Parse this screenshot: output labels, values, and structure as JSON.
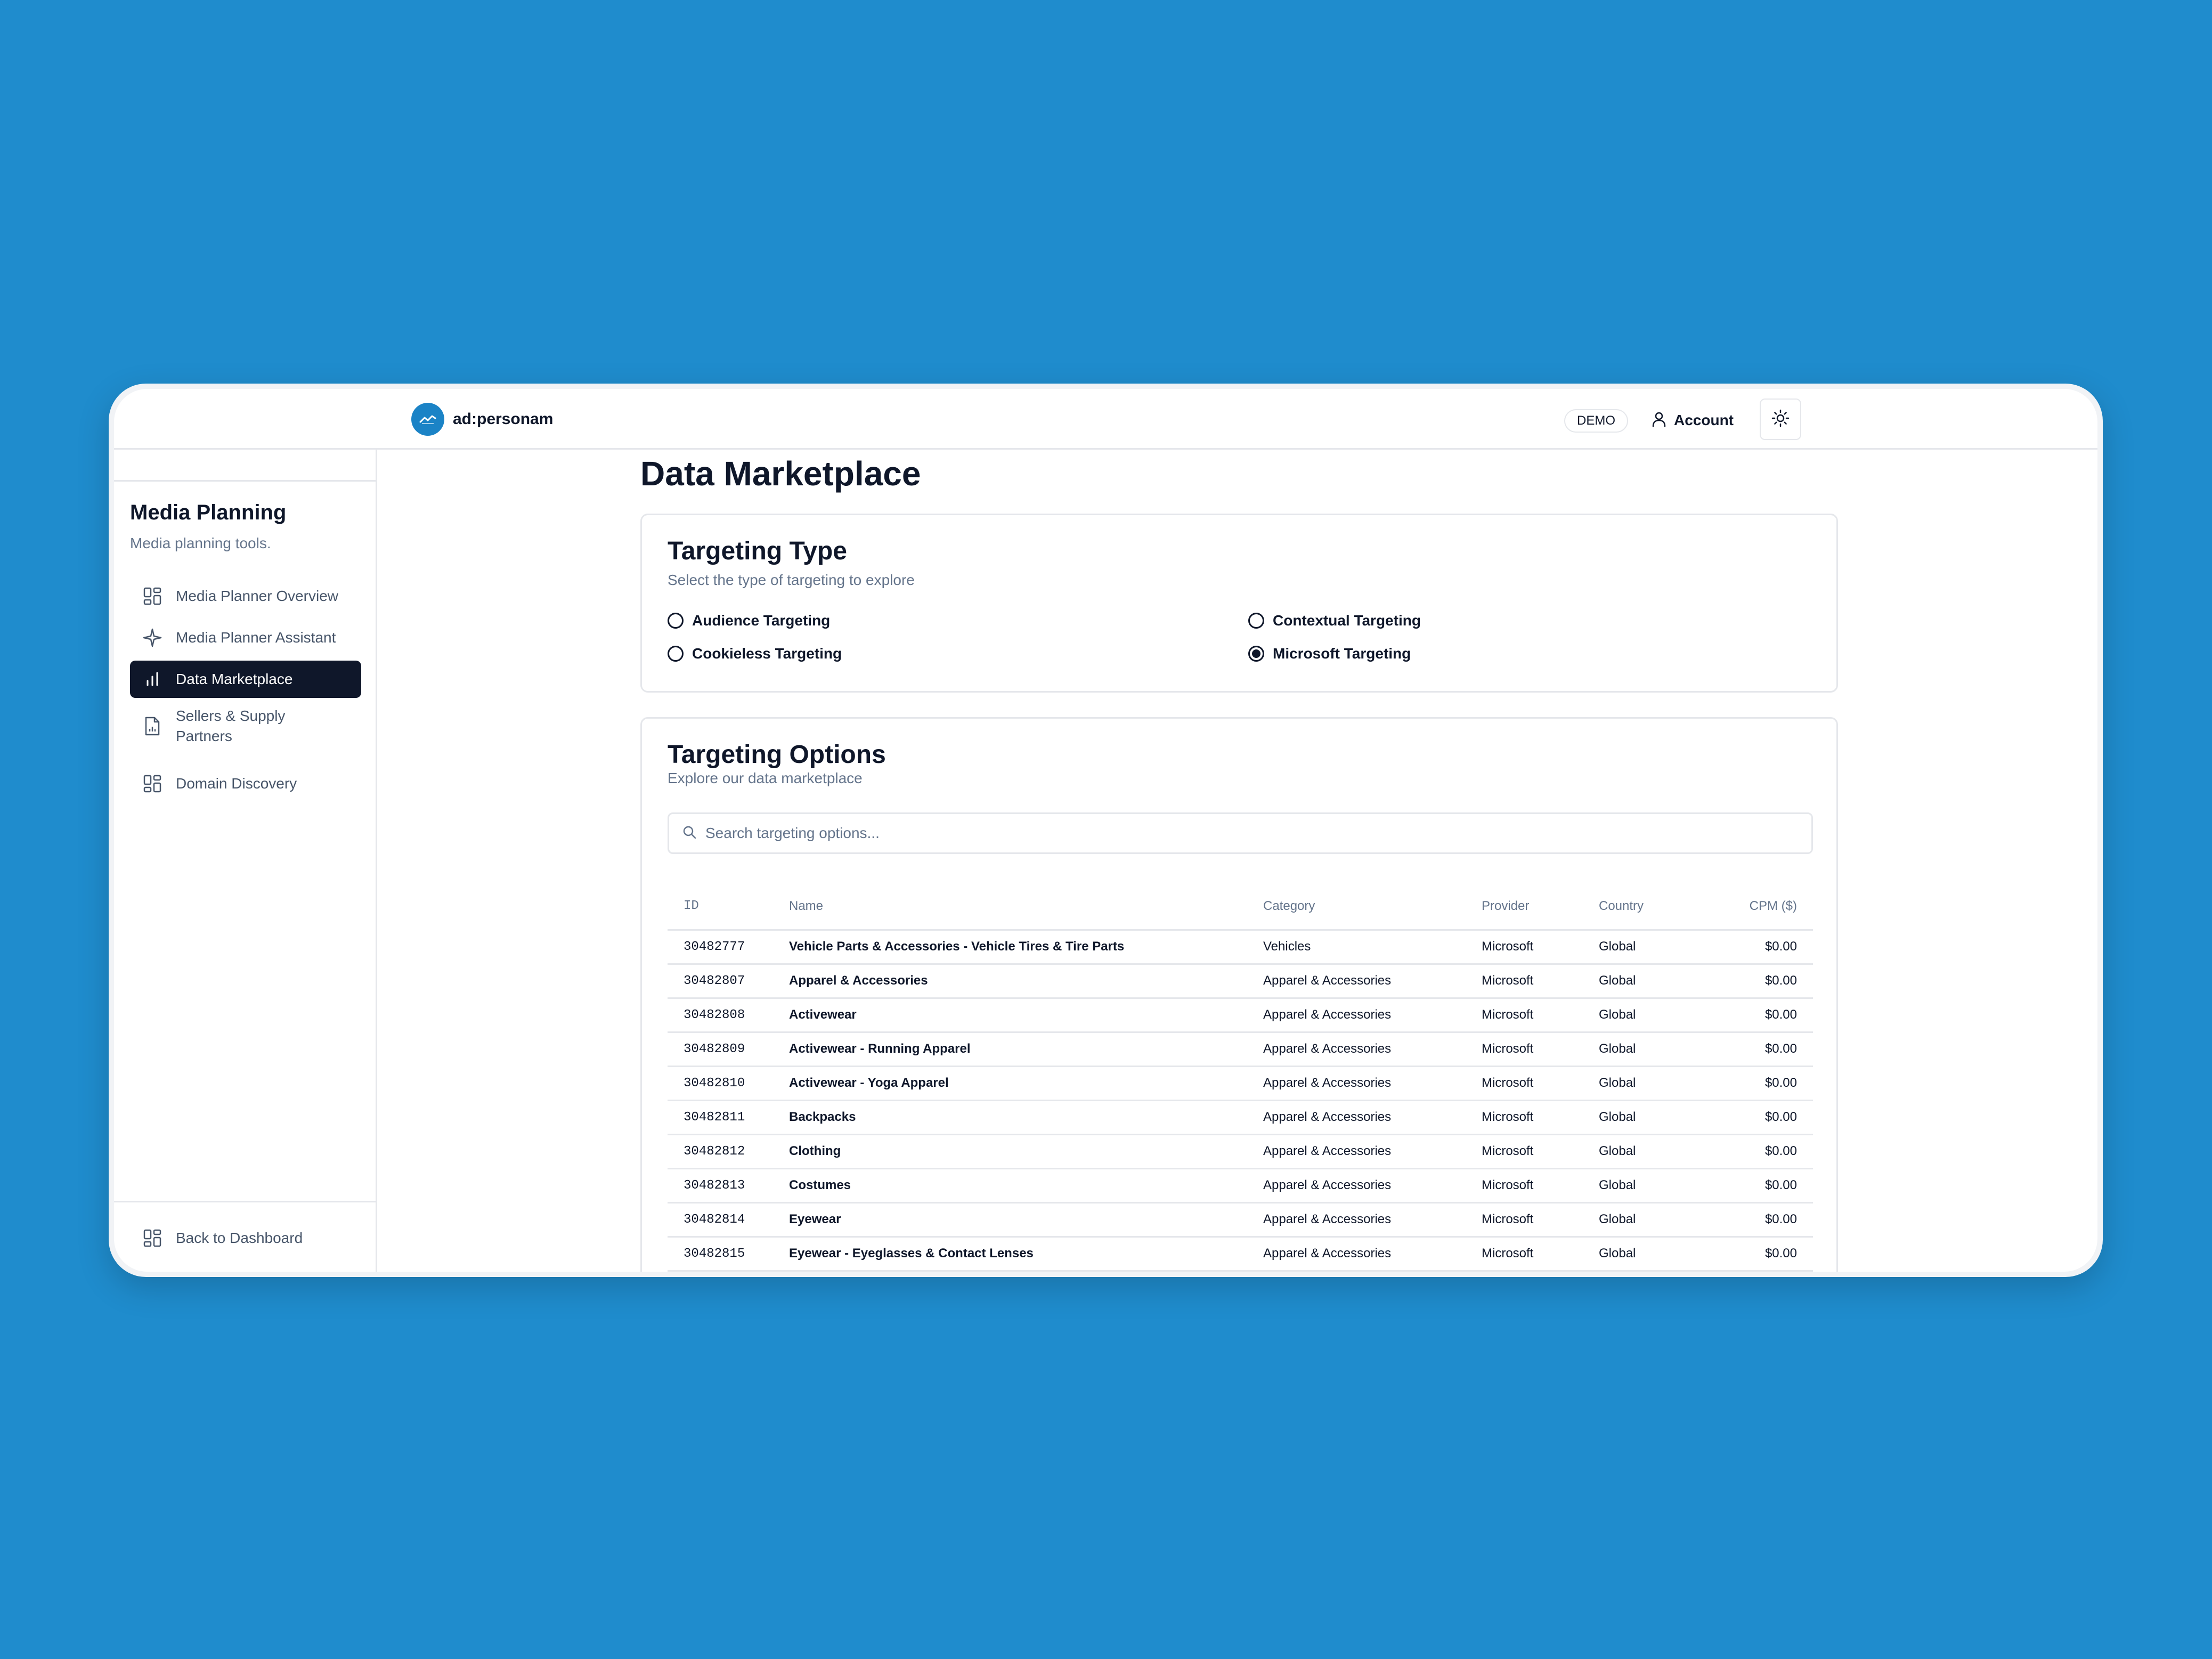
{
  "header": {
    "brand_name": "ad:personam",
    "demo_badge": "DEMO",
    "account_label": "Account"
  },
  "sidebar": {
    "title": "Media Planning",
    "subtitle": "Media planning tools.",
    "items": [
      {
        "label": "Media Planner Overview",
        "icon": "grid-icon",
        "active": false
      },
      {
        "label": "Media Planner Assistant",
        "icon": "sparkle-icon",
        "active": false
      },
      {
        "label": "Data Marketplace",
        "icon": "bar-chart-icon",
        "active": true
      },
      {
        "label": "Sellers & Supply Partners",
        "icon": "file-chart-icon",
        "active": false
      },
      {
        "label": "Domain Discovery",
        "icon": "grid-icon",
        "active": false
      }
    ],
    "back_label": "Back to Dashboard"
  },
  "main": {
    "page_title": "Data Marketplace",
    "targeting_type": {
      "title": "Targeting Type",
      "description": "Select the type of targeting to explore",
      "options": [
        {
          "label": "Audience Targeting",
          "selected": false
        },
        {
          "label": "Contextual Targeting",
          "selected": false
        },
        {
          "label": "Cookieless Targeting",
          "selected": false
        },
        {
          "label": "Microsoft Targeting",
          "selected": true
        }
      ]
    },
    "targeting_options": {
      "title": "Targeting Options",
      "description": "Explore our data marketplace",
      "search_placeholder": "Search targeting options...",
      "columns": [
        "ID",
        "Name",
        "Category",
        "Provider",
        "Country",
        "CPM ($)"
      ],
      "rows": [
        [
          "30482777",
          "Vehicle Parts & Accessories - Vehicle Tires & Tire Parts",
          "Vehicles",
          "Microsoft",
          "Global",
          "$0.00"
        ],
        [
          "30482807",
          "Apparel & Accessories",
          "Apparel & Accessories",
          "Microsoft",
          "Global",
          "$0.00"
        ],
        [
          "30482808",
          "Activewear",
          "Apparel & Accessories",
          "Microsoft",
          "Global",
          "$0.00"
        ],
        [
          "30482809",
          "Activewear - Running Apparel",
          "Apparel & Accessories",
          "Microsoft",
          "Global",
          "$0.00"
        ],
        [
          "30482810",
          "Activewear - Yoga Apparel",
          "Apparel & Accessories",
          "Microsoft",
          "Global",
          "$0.00"
        ],
        [
          "30482811",
          "Backpacks",
          "Apparel & Accessories",
          "Microsoft",
          "Global",
          "$0.00"
        ],
        [
          "30482812",
          "Clothing",
          "Apparel & Accessories",
          "Microsoft",
          "Global",
          "$0.00"
        ],
        [
          "30482813",
          "Costumes",
          "Apparel & Accessories",
          "Microsoft",
          "Global",
          "$0.00"
        ],
        [
          "30482814",
          "Eyewear",
          "Apparel & Accessories",
          "Microsoft",
          "Global",
          "$0.00"
        ],
        [
          "30482815",
          "Eyewear - Eyeglasses & Contact Lenses",
          "Apparel & Accessories",
          "Microsoft",
          "Global",
          "$0.00"
        ]
      ]
    }
  },
  "colors": {
    "background": "#1f8ccd",
    "active_nav": "#0f172a",
    "brand": "#1b83c6"
  }
}
